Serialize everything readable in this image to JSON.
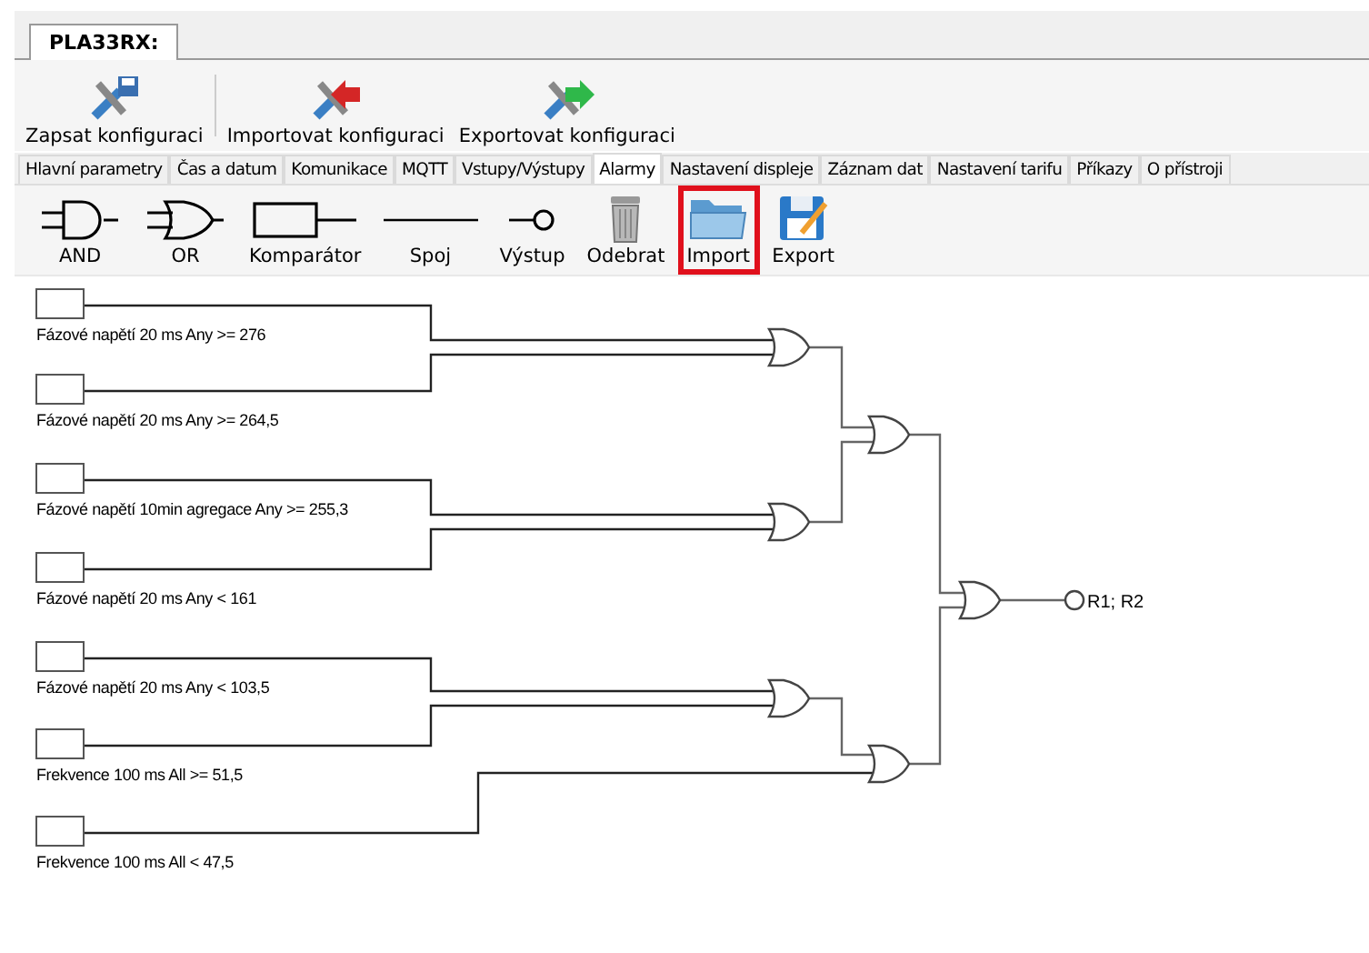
{
  "document_tab": {
    "label": "PLA33RX:",
    "selected": true
  },
  "config_toolbar": [
    {
      "label": "Zapsat konfiguraci",
      "kind": "write"
    },
    {
      "label": "Importovat konfiguraci",
      "kind": "import"
    },
    {
      "label": "Exportovat konfiguraci",
      "kind": "export"
    }
  ],
  "tabs": [
    {
      "label": "Hlavní parametry",
      "selected": false
    },
    {
      "label": "Čas a datum",
      "selected": false
    },
    {
      "label": "Komunikace",
      "selected": false
    },
    {
      "label": "MQTT",
      "selected": false
    },
    {
      "label": "Vstupy/Výstupy",
      "selected": false
    },
    {
      "label": "Alarmy",
      "selected": true
    },
    {
      "label": "Nastavení displeje",
      "selected": false
    },
    {
      "label": "Záznam dat",
      "selected": false
    },
    {
      "label": "Nastavení tarifu",
      "selected": false
    },
    {
      "label": "Příkazy",
      "selected": false
    },
    {
      "label": "O přístroji",
      "selected": false
    }
  ],
  "tools": [
    {
      "label": "AND",
      "kind": "and",
      "highlighted": false
    },
    {
      "label": "OR",
      "kind": "or",
      "highlighted": false
    },
    {
      "label": "Komparátor",
      "kind": "comparator",
      "highlighted": false
    },
    {
      "label": "Spoj",
      "kind": "wire",
      "highlighted": false
    },
    {
      "label": "Výstup",
      "kind": "output",
      "highlighted": false
    },
    {
      "label": "Odebrat",
      "kind": "delete",
      "highlighted": false
    },
    {
      "label": "Import",
      "kind": "import",
      "highlighted": true
    },
    {
      "label": "Export",
      "kind": "export",
      "highlighted": false
    }
  ],
  "diagram": {
    "inputs": [
      {
        "label": "Fázové napětí 20 ms Any >= 276"
      },
      {
        "label": "Fázové napětí 20 ms Any >= 264,5"
      },
      {
        "label": "Fázové napětí 10min agregace Any >= 255,3"
      },
      {
        "label": "Fázové napětí 20 ms Any < 161"
      },
      {
        "label": "Fázové napětí 20 ms Any < 103,5"
      },
      {
        "label": "Frekvence 100 ms All >= 51,5"
      },
      {
        "label": "Frekvence 100 ms All < 47,5"
      }
    ],
    "output": {
      "label": "R1; R2"
    }
  }
}
